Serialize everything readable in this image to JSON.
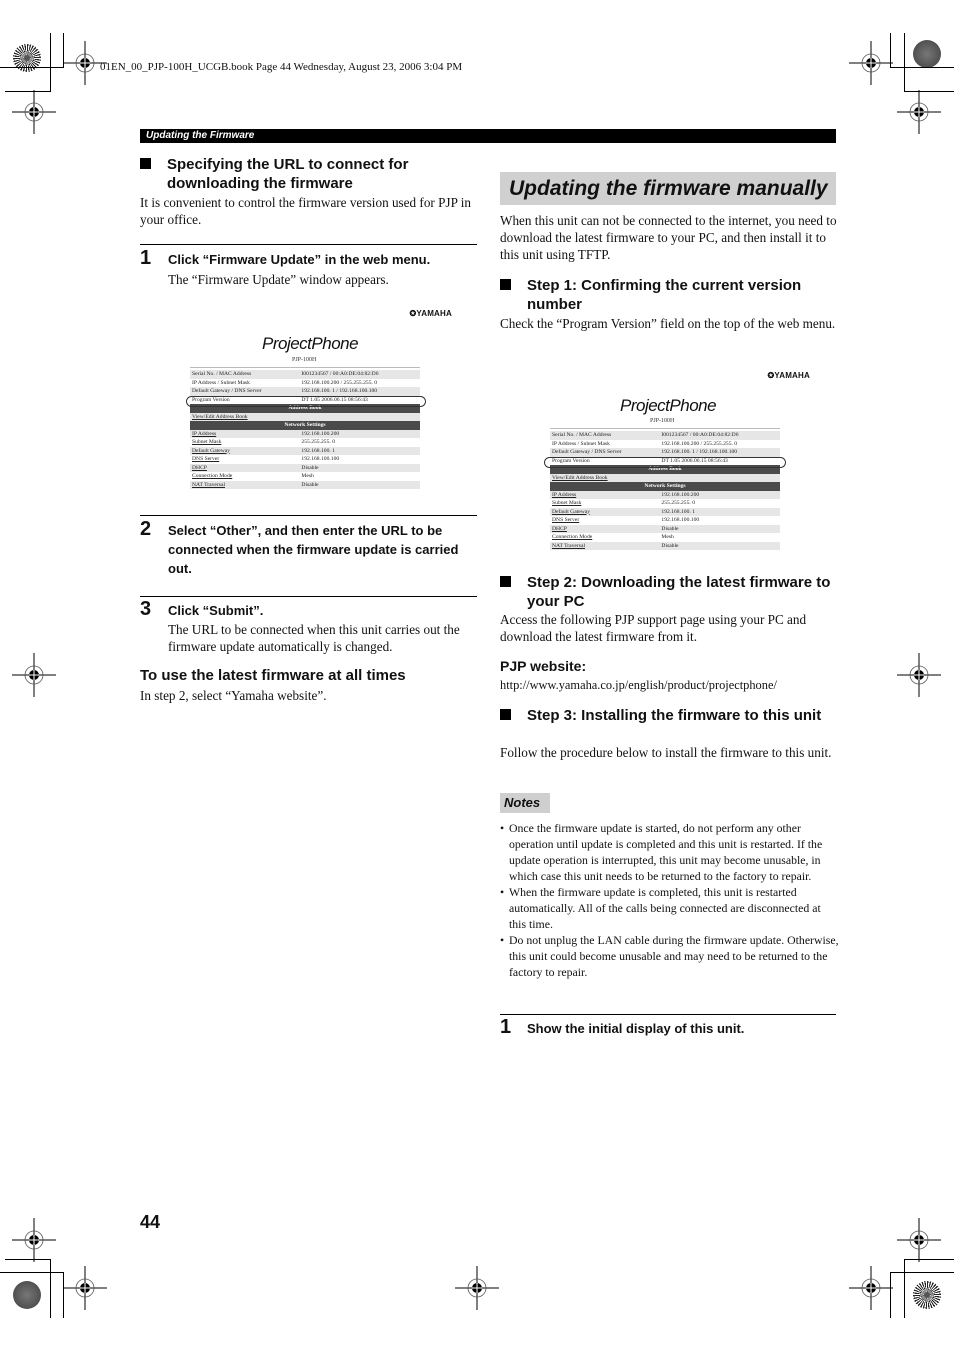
{
  "print_header": "01EN_00_PJP-100H_UCGB.book  Page 44  Wednesday, August 23, 2006  3:04 PM",
  "section_bar": "Updating the Firmware",
  "left_column": {
    "heading_specify": "Specifying the URL to connect for downloading the firmware",
    "intro": "It is convenient to control the firmware version used for PJP in your office.",
    "steps": [
      {
        "number": "1",
        "title": "Click “Firmware Update” in the web menu.",
        "body": "The “Firmware Update” window appears."
      },
      {
        "number": "2",
        "title": "Select “Other”, and then enter the URL to be connected when the firmware update is carried out.",
        "body": ""
      },
      {
        "number": "3",
        "title": "Click “Submit”.",
        "body": "The URL to be connected when this unit carries out the firmware update automatically is changed."
      }
    ],
    "subheading": "To use the latest firmware at all times",
    "subheading_body": "In step 2, select “Yamaha website”."
  },
  "screenshot": {
    "brand": "✪YAMAHA",
    "logo": "ProjectPhone",
    "model": "PJP-100H",
    "info_rows": [
      {
        "label": "Serial No. / MAC Address",
        "value": "I001234567 / 00:A0:DE:04:82:D6"
      },
      {
        "label": "IP Address / Subnet Mask",
        "value": "192.168.100.200 / 255.255.255. 0"
      },
      {
        "label": "Default Gateway / DNS Server",
        "value": "192.168.100. 1 / 192.168.100.100"
      },
      {
        "label": "Program Version",
        "value": "DT 1.05 2006.06.15 08:56:43"
      }
    ],
    "address_book_header": "Address Book",
    "address_book_link": "View/Edit Address Book",
    "network_header": "Network Settings",
    "network_rows": [
      {
        "label": "IP Address",
        "value": "192.168.100.200"
      },
      {
        "label": "Subnet Mask",
        "value": "255.255.255. 0"
      },
      {
        "label": "Default Gateway",
        "value": "192.168.100. 1"
      },
      {
        "label": "DNS Server",
        "value": "192.168.100.100"
      },
      {
        "label": "DHCP",
        "value": "Disable"
      },
      {
        "label": "Connection Mode",
        "value": "Mesh"
      },
      {
        "label": "NAT Traversal",
        "value": "Disable"
      }
    ]
  },
  "right_column": {
    "title": "Updating the firmware manually",
    "intro": "When this unit can not be connected to the internet, you need to download the latest firmware to your PC, and then install it to this unit using TFTP.",
    "step1_heading": "Step 1: Confirming the current version number",
    "step1_body": "Check the “Program Version” field on the top of the web menu.",
    "step2_heading": "Step 2: Downloading the latest firmware to your PC",
    "step2_body": "Access the following PJP support page using your PC and download the latest firmware from it.",
    "website_label": "PJP website:",
    "website_url": "http://www.yamaha.co.jp/english/product/projectphone/",
    "step3_heading": "Step 3: Installing the firmware to this unit",
    "step3_body": "Follow the procedure below to install the firmware to this unit.",
    "notes_label": "Notes",
    "notes": [
      "Once the firmware update is started, do not perform any other operation until update is completed and this unit is restarted. If the update operation is interrupted, this unit may become unusable, in which case this unit needs to be returned to the factory to repair.",
      "When the firmware update is completed, this unit is restarted automatically. All of the calls being connected are disconnected at this time.",
      "Do not unplug the LAN cable during the firmware update. Otherwise, this unit could become unusable and may need to be returned to the factory to repair."
    ],
    "final_step": {
      "number": "1",
      "title": "Show the initial display of this unit."
    }
  },
  "page_number": "44"
}
